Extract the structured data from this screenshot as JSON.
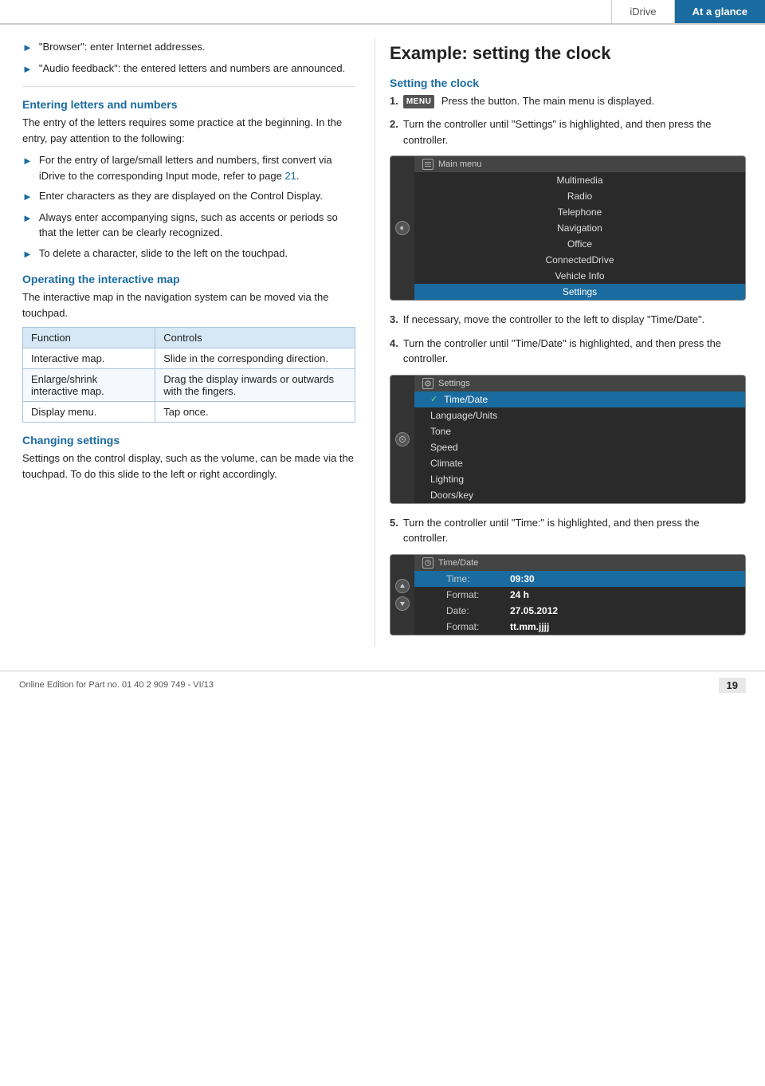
{
  "header": {
    "tab_idrive": "iDrive",
    "tab_at_glance": "At a glance"
  },
  "left_col": {
    "bullets_top": [
      "\"Browser\": enter Internet addresses.",
      "\"Audio feedback\": the entered letters and numbers are announced."
    ],
    "section1_heading": "Entering letters and numbers",
    "section1_body": "The entry of the letters requires some practice at the beginning. In the entry, pay attention to the following:",
    "section1_bullets": [
      "For the entry of large/small letters and numbers, first convert via iDrive to the corresponding Input mode, refer to page 21.",
      "Enter characters as they are displayed on the Control Display.",
      "Always enter accompanying signs, such as accents or periods so that the letter can be clearly recognized.",
      "To delete a character, slide to the left on the touchpad."
    ],
    "page_ref": "21",
    "section2_heading": "Operating the interactive map",
    "section2_body": "The interactive map in the navigation system can be moved via the touchpad.",
    "table": {
      "col1_header": "Function",
      "col2_header": "Controls",
      "rows": [
        {
          "function": "Interactive map.",
          "controls": "Slide in the corresponding direction."
        },
        {
          "function": "Enlarge/shrink interactive map.",
          "controls": "Drag the display inwards or outwards with the fingers."
        },
        {
          "function": "Display menu.",
          "controls": "Tap once."
        }
      ]
    },
    "section3_heading": "Changing settings",
    "section3_body": "Settings on the control display, such as the volume, can be made via the touchpad. To do this slide to the left or right accordingly."
  },
  "right_col": {
    "main_heading": "Example: setting the clock",
    "section_heading": "Setting the clock",
    "steps": [
      {
        "num": "1.",
        "text": "Press the button. The main menu is displayed.",
        "has_menu_badge": true
      },
      {
        "num": "2.",
        "text": "Turn the controller until \"Settings\" is highlighted, and then press the controller."
      },
      {
        "num": "3.",
        "text": "If necessary, move the controller to the left to display \"Time/Date\"."
      },
      {
        "num": "4.",
        "text": "Turn the controller until \"Time/Date\" is highlighted, and then press the controller."
      },
      {
        "num": "5.",
        "text": "Turn the controller until \"Time:\" is highlighted, and then press the controller."
      }
    ],
    "screen1": {
      "title": "Main menu",
      "items": [
        "Multimedia",
        "Radio",
        "Telephone",
        "Navigation",
        "Office",
        "ConnectedDrive",
        "Vehicle Info",
        "Settings"
      ],
      "highlighted": "Settings"
    },
    "screen2": {
      "title": "Settings",
      "items": [
        "Time/Date",
        "Language/Units",
        "Tone",
        "Speed",
        "Climate",
        "Lighting",
        "Doors/key"
      ],
      "highlighted": "Time/Date",
      "checked": "Time/Date"
    },
    "screen3": {
      "title": "Time/Date",
      "rows": [
        {
          "label": "Time:",
          "value": "09:30",
          "highlighted": true
        },
        {
          "label": "Format:",
          "value": "24 h",
          "highlighted": false
        },
        {
          "label": "Date:",
          "value": "27.05.2012",
          "highlighted": false
        },
        {
          "label": "Format:",
          "value": "tt.mm.jjjj",
          "highlighted": false
        }
      ]
    }
  },
  "footer": {
    "text": "Online Edition for Part no. 01 40 2 909 749 - VI/13",
    "page_number": "19"
  }
}
